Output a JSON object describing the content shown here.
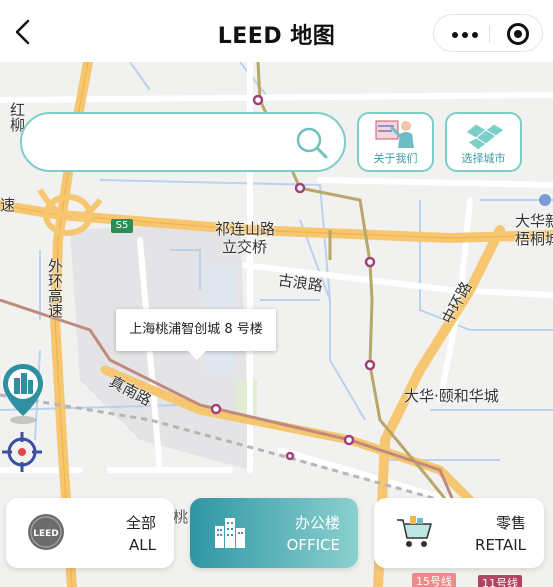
{
  "header": {
    "title": "LEED 地图"
  },
  "search": {
    "placeholder": ""
  },
  "side_buttons": {
    "about": "关于我们",
    "select_city": "选择城市"
  },
  "map": {
    "labels": {
      "hongliu": "红柳",
      "qilianshan_road": "祁连山路",
      "lijiaoqiao": "立交桥",
      "gulang_road": "古浪路",
      "waihuan_gaosu": "外环高速",
      "zhenan_road": "真南路",
      "zhonghuan_road": "中环路",
      "dahua_yihehuacheng": "大华·颐和华城",
      "dahua_xin": "大华新",
      "wutonglv": "梧桐城",
      "su": "速",
      "tao": "桃",
      "s5": "S5",
      "line15": "15号线",
      "line11": "11号线"
    },
    "marker": {
      "callout": "上海桃浦智创城 8 号楼"
    }
  },
  "tabs": [
    {
      "cn": "全部",
      "en": "ALL",
      "icon": "leed-badge-icon",
      "active": false
    },
    {
      "cn": "办公楼",
      "en": "OFFICE",
      "icon": "office-building-icon",
      "active": true
    },
    {
      "cn": "零售",
      "en": "RETAIL",
      "icon": "shopping-cart-icon",
      "active": false
    }
  ],
  "colors": {
    "accent_teal": "#7fcdc7",
    "active_tab_start": "#2f96a4",
    "active_tab_end": "#8bd0cf",
    "locate_blue": "#3a4fa3",
    "road_orange": "#f6c770"
  }
}
